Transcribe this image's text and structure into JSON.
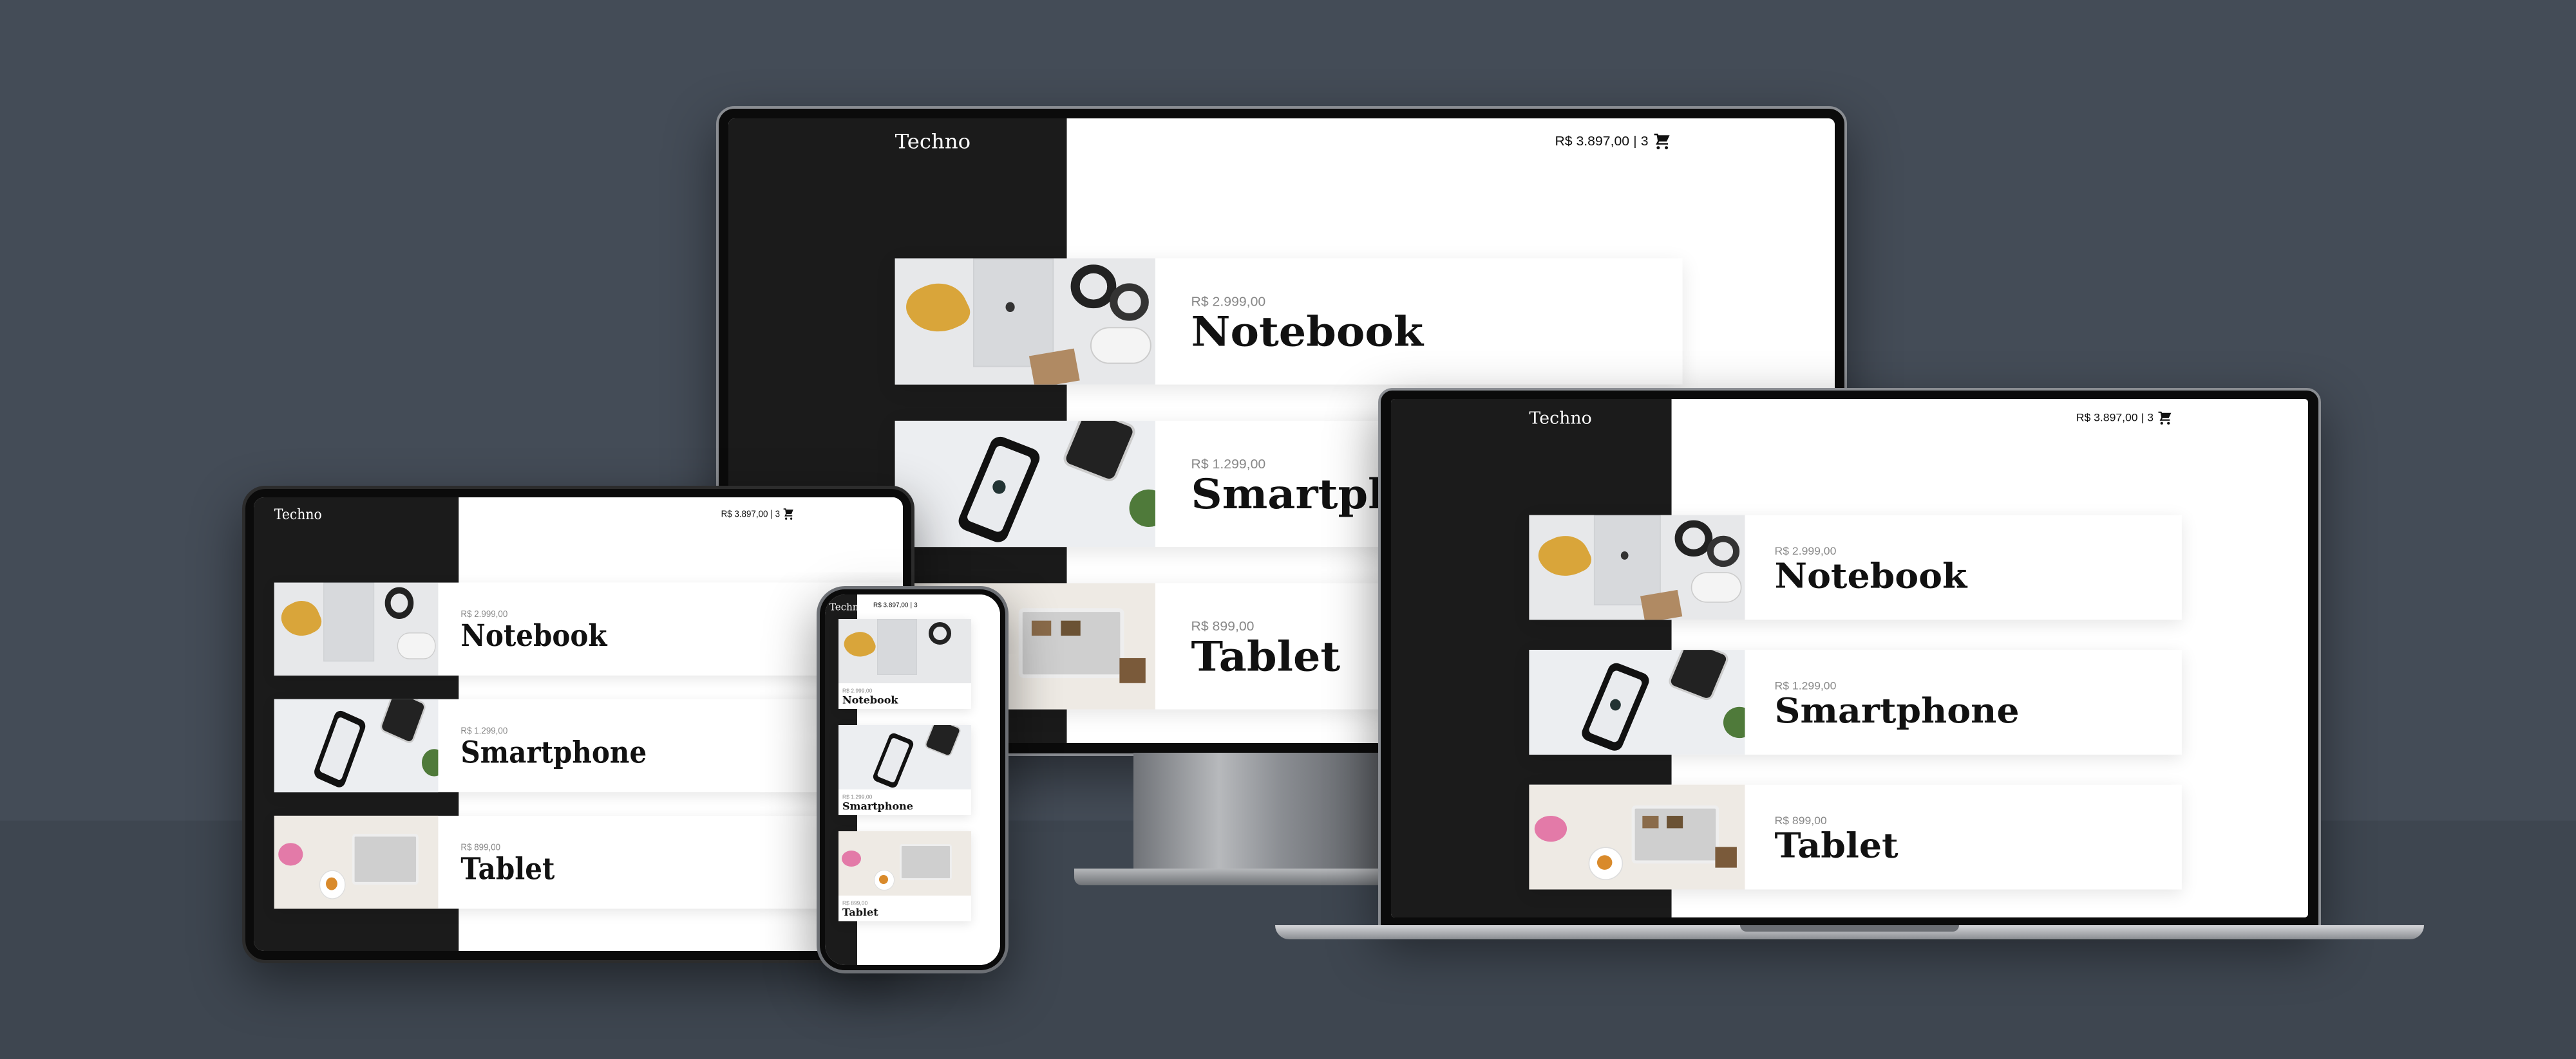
{
  "site": {
    "logo": "Techno",
    "cart_total": "R$ 3.897,00",
    "cart_separator": "|",
    "cart_count": "3",
    "products": [
      {
        "name": "Notebook",
        "price": "R$ 2.999,00"
      },
      {
        "name": "Smartphone",
        "price": "R$ 1.299,00"
      },
      {
        "name": "Tablet",
        "price": "R$ 899,00"
      }
    ]
  },
  "devices": [
    "imac",
    "macbook",
    "ipad",
    "iphone"
  ],
  "icons": {
    "cart": "shopping-cart-icon"
  },
  "colors": {
    "background": "#444c57",
    "sidebar": "#1b1b1b",
    "price": "#888888",
    "text": "#111111"
  }
}
